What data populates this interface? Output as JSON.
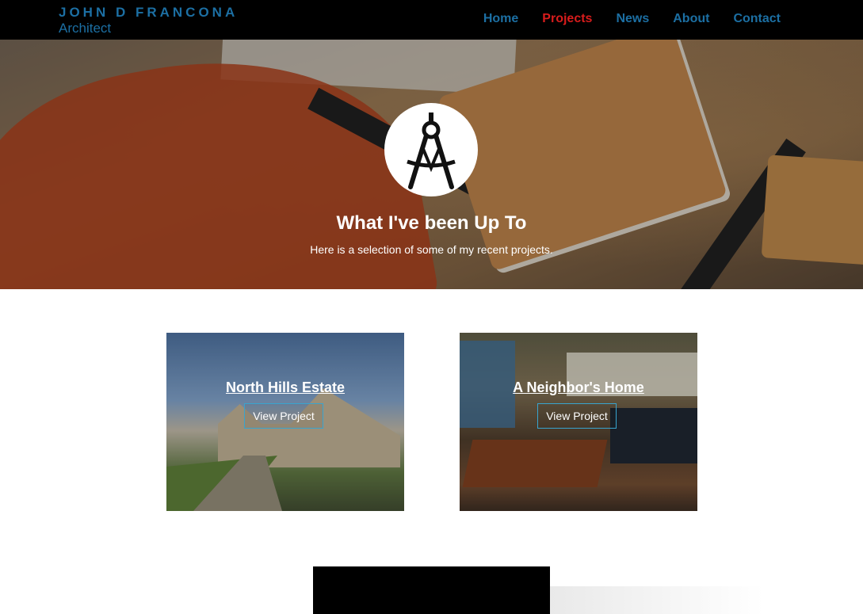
{
  "header": {
    "brand_name": "JOHN D FRANCONA",
    "brand_tagline": "Architect",
    "nav": [
      {
        "label": "Home",
        "active": false
      },
      {
        "label": "Projects",
        "active": true
      },
      {
        "label": "News",
        "active": false
      },
      {
        "label": "About",
        "active": false
      },
      {
        "label": "Contact",
        "active": false
      }
    ]
  },
  "hero": {
    "icon": "compass-icon",
    "title": "What I've been Up To",
    "subtitle": "Here is a selection of some of my recent projects."
  },
  "projects": [
    {
      "title": "North Hills Estate",
      "button": "View Project"
    },
    {
      "title": "A Neighbor's Home",
      "button": "View Project"
    }
  ],
  "colors": {
    "brand_blue": "#1c6fa3",
    "active_red": "#d81c1c",
    "nav_background": "#000000",
    "button_border": "#38a4cf"
  }
}
